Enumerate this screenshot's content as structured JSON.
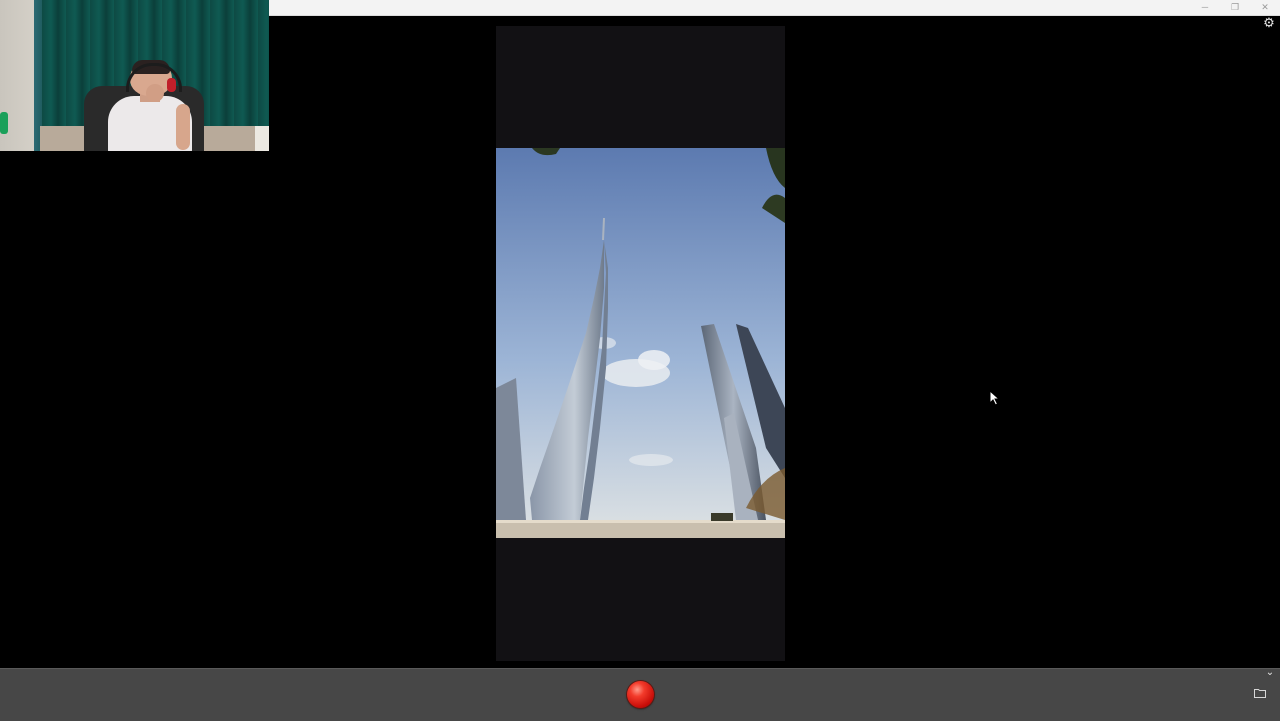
{
  "window": {
    "controls": {
      "minimize": "─",
      "restore": "❐",
      "close": "✕"
    }
  },
  "toolbar": {
    "settings_icon": "gear-icon",
    "collapse_icon": "chevron-down-icon",
    "folder_icon": "folder-icon"
  },
  "recorder": {
    "record_icon": "record-icon",
    "accent": "#e3261a"
  },
  "colors": {
    "background": "#000000",
    "titlebar": "#f3f3f3",
    "bottombar": "#474747",
    "phone_frame": "#121114"
  }
}
